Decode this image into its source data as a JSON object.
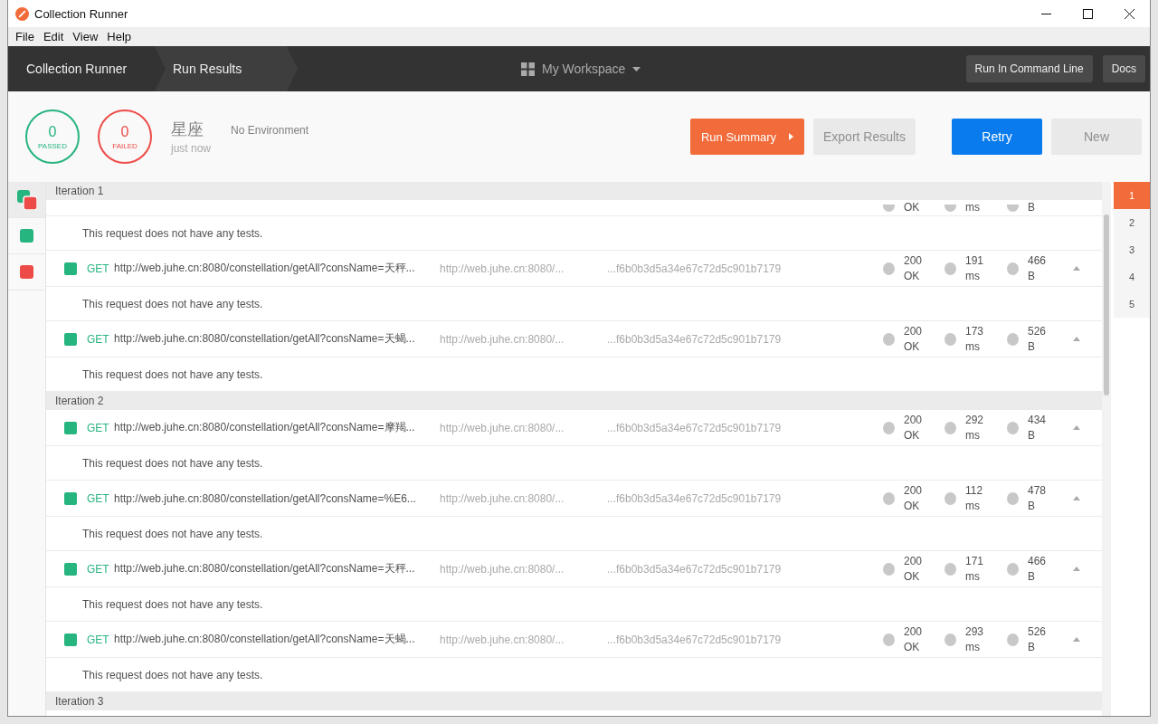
{
  "window": {
    "title": "Collection Runner"
  },
  "menu": [
    "File",
    "Edit",
    "View",
    "Help"
  ],
  "breadcrumbs": [
    {
      "label": "Collection Runner",
      "selected": false
    },
    {
      "label": "Run Results",
      "selected": true
    }
  ],
  "workspace": "My Workspace",
  "header_buttons": [
    "Run In Command Line",
    "Docs"
  ],
  "summary": {
    "passed": "0",
    "passed_label": "PASSED",
    "failed": "0",
    "failed_label": "FAILED",
    "collection": "星座",
    "time": "just now",
    "environment": "No Environment"
  },
  "actions": [
    {
      "label": "Run Summary",
      "kind": "orange"
    },
    {
      "label": "Export Results",
      "kind": "muted"
    },
    {
      "label": "Retry",
      "kind": "blue"
    },
    {
      "label": "New",
      "kind": "muted"
    }
  ],
  "filters": [
    {
      "kind": "all",
      "selected": true
    },
    {
      "kind": "passed",
      "selected": false
    },
    {
      "kind": "failed",
      "selected": false
    }
  ],
  "iterations": [
    {
      "title": "Iteration 1",
      "requests": [
        {
          "cut": true,
          "status": "OK",
          "time": "ms",
          "size": "B",
          "note": "This request does not have any tests."
        },
        {
          "passed": true,
          "method": "GET",
          "url": "http://web.juhe.cn:8080/constellation/getAll?consName=天秤...",
          "url2": "http://web.juhe.cn:8080/...",
          "hash": "...f6b0b3d5a34e67c72d5c901b7179",
          "status": "200 OK",
          "time": "191 ms",
          "size": "466 B",
          "note": "This request does not have any tests."
        },
        {
          "passed": true,
          "method": "GET",
          "url": "http://web.juhe.cn:8080/constellation/getAll?consName=天蝎...",
          "url2": "http://web.juhe.cn:8080/...",
          "hash": "...f6b0b3d5a34e67c72d5c901b7179",
          "status": "200 OK",
          "time": "173 ms",
          "size": "526 B",
          "note": "This request does not have any tests."
        }
      ]
    },
    {
      "title": "Iteration 2",
      "requests": [
        {
          "passed": true,
          "method": "GET",
          "url": "http://web.juhe.cn:8080/constellation/getAll?consName=摩羯...",
          "url2": "http://web.juhe.cn:8080/...",
          "hash": "...f6b0b3d5a34e67c72d5c901b7179",
          "status": "200 OK",
          "time": "292 ms",
          "size": "434 B",
          "note": "This request does not have any tests."
        },
        {
          "passed": true,
          "method": "GET",
          "url": "http://web.juhe.cn:8080/constellation/getAll?consName=%E6...",
          "url2": "http://web.juhe.cn:8080/...",
          "hash": "...f6b0b3d5a34e67c72d5c901b7179",
          "status": "200 OK",
          "time": "112 ms",
          "size": "478 B",
          "note": "This request does not have any tests."
        },
        {
          "passed": true,
          "method": "GET",
          "url": "http://web.juhe.cn:8080/constellation/getAll?consName=天秤...",
          "url2": "http://web.juhe.cn:8080/...",
          "hash": "...f6b0b3d5a34e67c72d5c901b7179",
          "status": "200 OK",
          "time": "171 ms",
          "size": "466 B",
          "note": "This request does not have any tests."
        },
        {
          "passed": true,
          "method": "GET",
          "url": "http://web.juhe.cn:8080/constellation/getAll?consName=天蝎...",
          "url2": "http://web.juhe.cn:8080/...",
          "hash": "...f6b0b3d5a34e67c72d5c901b7179",
          "status": "200 OK",
          "time": "293 ms",
          "size": "526 B",
          "note": "This request does not have any tests."
        }
      ]
    },
    {
      "title": "Iteration 3"
    }
  ],
  "iteration_nav": [
    {
      "label": "1",
      "selected": true
    },
    {
      "label": "2",
      "selected": false
    },
    {
      "label": "3",
      "selected": false
    },
    {
      "label": "4",
      "selected": false
    },
    {
      "label": "5",
      "selected": false
    }
  ]
}
